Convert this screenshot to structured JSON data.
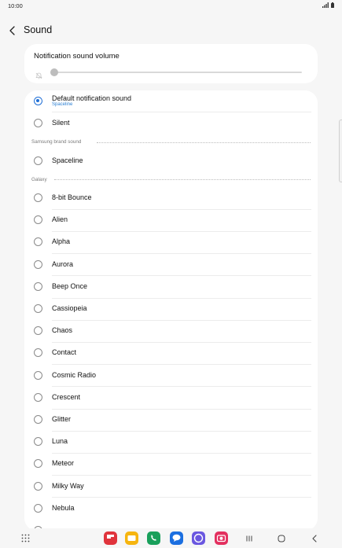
{
  "status_bar": {
    "time": "10:00"
  },
  "header": {
    "title": "Sound"
  },
  "volume": {
    "label": "Notification sound volume",
    "level": 0
  },
  "default_option": {
    "label": "Default notification sound",
    "sublabel": "Spaceline",
    "selected": true
  },
  "silent_option": {
    "label": "Silent"
  },
  "sections": {
    "samsung": {
      "title": "Samsung brand sound",
      "items": [
        "Spaceline"
      ]
    },
    "galaxy": {
      "title": "Galaxy",
      "items": [
        "8-bit Bounce",
        "Alien",
        "Alpha",
        "Aurora",
        "Beep Once",
        "Cassiopeia",
        "Chaos",
        "Contact",
        "Cosmic Radio",
        "Crescent",
        "Glitter",
        "Luna",
        "Meteor",
        "Milky Way",
        "Nebula"
      ]
    }
  },
  "dock": {
    "apps": [
      {
        "name": "flipboard-icon",
        "color": "#e0343c"
      },
      {
        "name": "my-files-icon",
        "color": "#f6b50f"
      },
      {
        "name": "phone-icon",
        "color": "#19a05b"
      },
      {
        "name": "messages-icon",
        "color": "#1b6fe0"
      },
      {
        "name": "internet-icon",
        "color": "#6a57e0"
      },
      {
        "name": "camera-icon",
        "color": "#e3305f"
      }
    ]
  }
}
